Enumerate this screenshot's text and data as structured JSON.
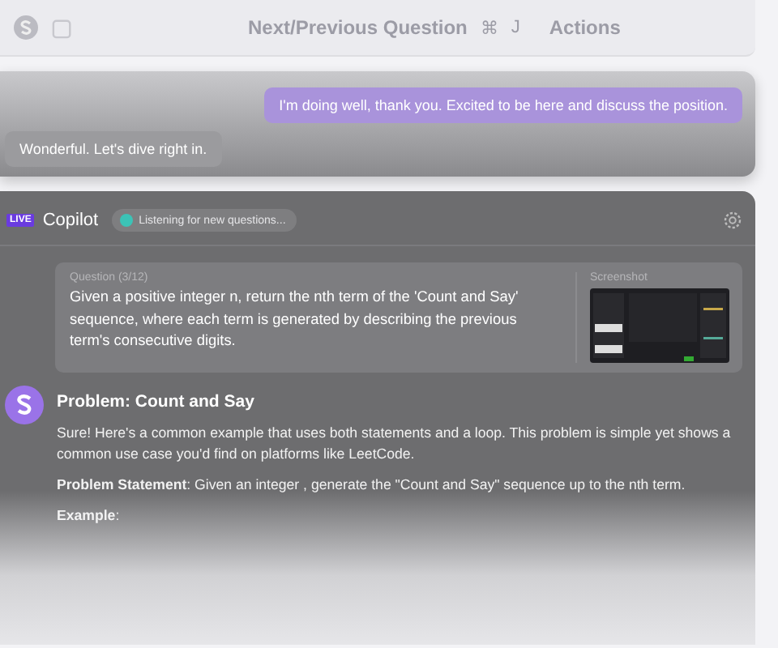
{
  "toolbar": {
    "label": "Next/Previous Question",
    "keys": [
      "⌘",
      "J"
    ],
    "actions_label": "Actions"
  },
  "chat": [
    {
      "text": "I'm doing well, thank you. Excited to be here and discuss the position.",
      "kind": "sent"
    },
    {
      "text": "Wonderful. Let's dive right in.",
      "kind": "received"
    }
  ],
  "copilot": {
    "badge": "LIVE",
    "title": "Copilot",
    "status": "Listening for new questions...",
    "question": {
      "label": "Question (3/12)",
      "text": "Given a positive integer n, return the nth term of the 'Count and Say' sequence, where each term is generated by describing the previous term's consecutive digits.",
      "screenshot_label": "Screenshot"
    },
    "answer": {
      "title": "Problem: Count and Say",
      "paragraphs": [
        "Sure! Here's a common example that uses both statements and a loop. This problem is simple yet shows a common use case you'd find on platforms like LeetCode.",
        "**Problem Statement**: Given an integer , generate the \"Count and Say\" sequence up to the nth term.",
        "**Example**:"
      ]
    }
  }
}
